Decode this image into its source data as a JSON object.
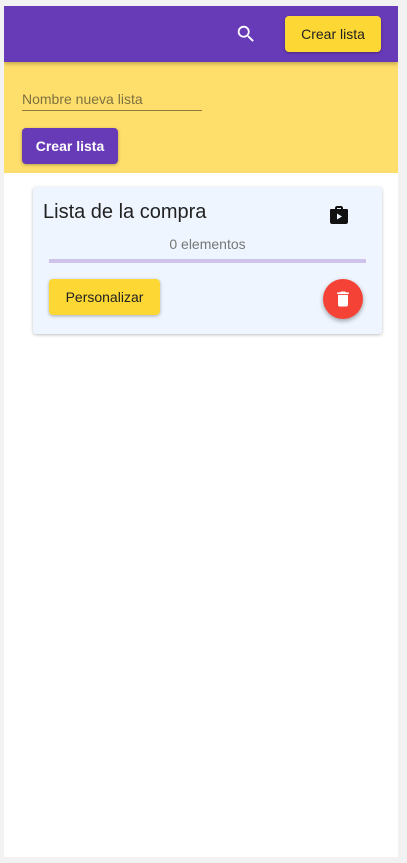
{
  "header": {
    "search_icon": "search-icon",
    "create_button_label": "Crear lista"
  },
  "create_panel": {
    "name_placeholder": "Nombre nueva lista",
    "name_value": "",
    "create_button_label": "Crear lista"
  },
  "lists": [
    {
      "title": "Lista de la compra",
      "count_text": "0 elementos",
      "icon": "shop-icon",
      "customize_label": "Personalizar",
      "delete_icon": "trash-icon"
    }
  ],
  "colors": {
    "primary": "#673ab7",
    "accent": "#fdd835",
    "panel": "#ffdf6b",
    "card": "#eef5fe",
    "danger": "#f44336"
  }
}
